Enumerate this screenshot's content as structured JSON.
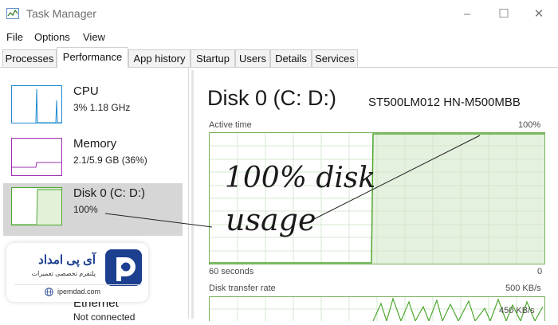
{
  "window": {
    "title": "Task Manager",
    "controls": [
      "–",
      "☐",
      "✕"
    ]
  },
  "menu": [
    "File",
    "Options",
    "View"
  ],
  "tabs": [
    "Processes",
    "Performance",
    "App history",
    "Startup",
    "Users",
    "Details",
    "Services"
  ],
  "active_tab": "Performance",
  "sidebar": [
    {
      "name": "CPU",
      "value": "3% 1.18 GHz",
      "color": "#1f8bcf",
      "level": 0.03
    },
    {
      "name": "Memory",
      "value": "2.1/5.9 GB (36%)",
      "color": "#9b2fae",
      "level": 0.36
    },
    {
      "name": "Disk 0 (C: D:)",
      "value": "100%",
      "color": "#4ea72e",
      "level": 1.0,
      "selected": true
    },
    {
      "name": "Ethernet",
      "value": "Not connected",
      "color": "#a36d1a"
    }
  ],
  "detail": {
    "title": "Disk 0 (C: D:)",
    "model": "ST500LM012 HN-M500MBB",
    "active_time": {
      "label": "Active time",
      "max_label": "100%",
      "time_label": "60 seconds",
      "zero_label": "0"
    },
    "transfer_rate": {
      "label": "Disk transfer rate",
      "max_label": "500 KB/s",
      "mid_label": "450 KB/s"
    }
  },
  "annotation": {
    "line1": "100% disk",
    "line2": "usage"
  },
  "logo": {
    "name": "آی پی امداد",
    "tagline": "پلتفرم تخصصی تعمیرات",
    "url": "ipemdad.com",
    "color": "#1c3f8f"
  }
}
